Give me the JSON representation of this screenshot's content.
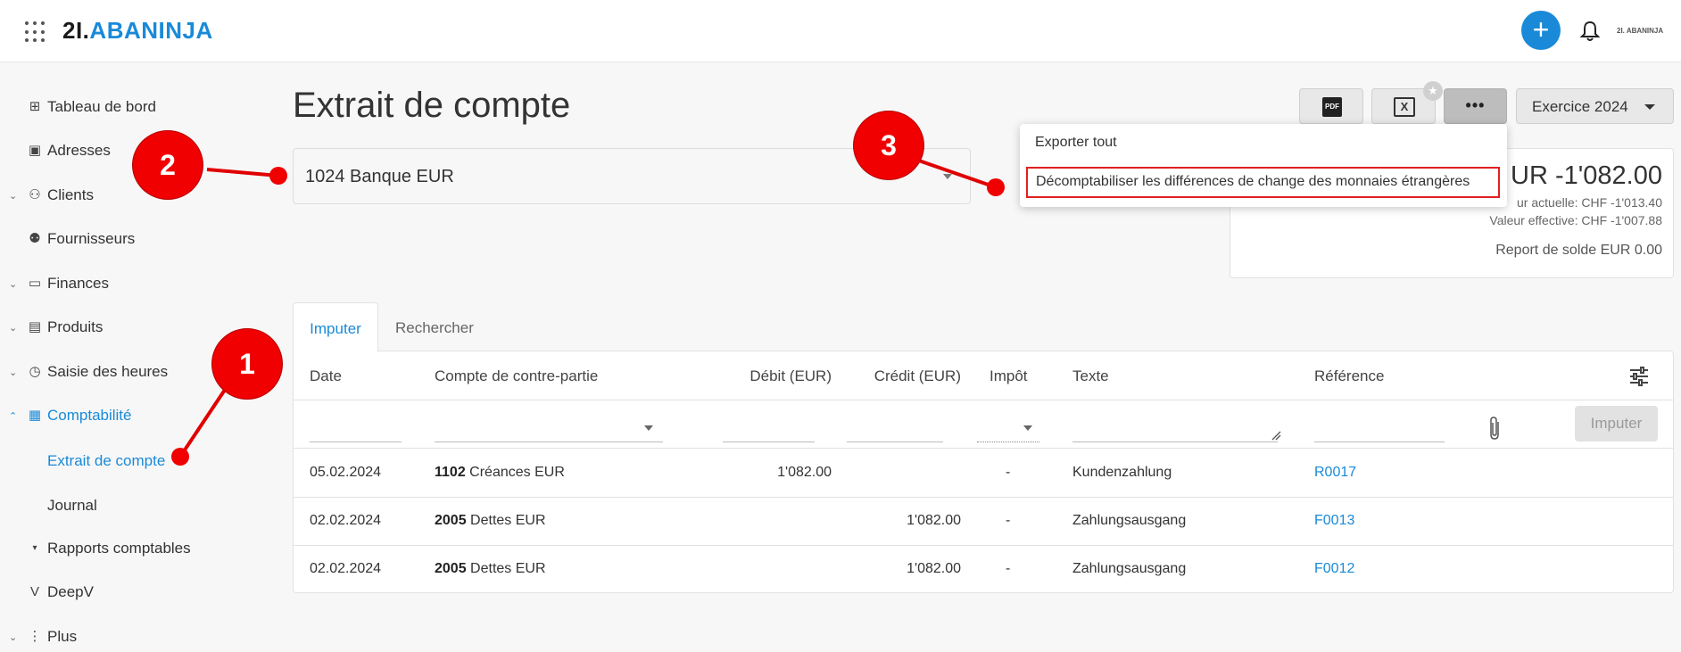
{
  "app": {
    "logo_prefix": "2I.",
    "logo_brand": "ABANINJA",
    "mini_logo": "2I. ABANINJA",
    "plus_label": "+"
  },
  "sidebar": {
    "items": [
      {
        "label": "Tableau de bord",
        "icon": "dashboard-icon"
      },
      {
        "label": "Adresses",
        "icon": "address-book-icon"
      },
      {
        "label": "Clients",
        "icon": "clients-icon"
      },
      {
        "label": "Fournisseurs",
        "icon": "suppliers-icon"
      },
      {
        "label": "Finances",
        "icon": "finances-icon"
      },
      {
        "label": "Produits",
        "icon": "products-icon"
      },
      {
        "label": "Saisie des heures",
        "icon": "timer-icon"
      },
      {
        "label": "Comptabilité",
        "icon": "calculator-icon"
      },
      {
        "label": "Extrait de compte"
      },
      {
        "label": "Journal"
      },
      {
        "label": "Rapports comptables"
      },
      {
        "label": "DeepV",
        "icon": "deepv-icon"
      },
      {
        "label": "Plus",
        "icon": "more-vertical-icon"
      }
    ]
  },
  "main": {
    "title": "Extrait de compte",
    "account_value": "1024 Banque EUR",
    "year_label": "Exercice 2024",
    "more_label": "•••",
    "pdf_label": "PDF",
    "xls_label": "X"
  },
  "balance": {
    "main": "UR -1'082.00",
    "current": "ur actuelle: CHF -1'013.40",
    "effective": "Valeur effective: CHF -1'007.88",
    "carry": "Report de solde EUR 0.00"
  },
  "menu": {
    "items": [
      "Exporter tout",
      "Décomptabiliser les différences de change des monnaies étrangères"
    ]
  },
  "tabs": [
    {
      "label": "Imputer"
    },
    {
      "label": "Rechercher"
    }
  ],
  "table": {
    "headers": [
      "Date",
      "Compte de contre-partie",
      "Débit (EUR)",
      "Crédit (EUR)",
      "Impôt",
      "Texte",
      "Référence"
    ],
    "post_button": "Imputer",
    "rows": [
      {
        "date": "05.02.2024",
        "acc_no": "1102",
        "acc_name": "Créances EUR",
        "debit": "1'082.00",
        "credit": "",
        "tax": "-",
        "text": "Kundenzahlung",
        "ref": "R0017"
      },
      {
        "date": "02.02.2024",
        "acc_no": "2005",
        "acc_name": "Dettes EUR",
        "debit": "",
        "credit": "1'082.00",
        "tax": "-",
        "text": "Zahlungsausgang",
        "ref": "F0013"
      },
      {
        "date": "02.02.2024",
        "acc_no": "2005",
        "acc_name": "Dettes EUR",
        "debit": "",
        "credit": "1'082.00",
        "tax": "-",
        "text": "Zahlungsausgang",
        "ref": "F0012"
      }
    ]
  },
  "annotations": [
    "1",
    "2",
    "3"
  ],
  "colors": {
    "accent": "#1a8ad8",
    "annotation": "#f00000",
    "highlight_border": "#e02020"
  }
}
